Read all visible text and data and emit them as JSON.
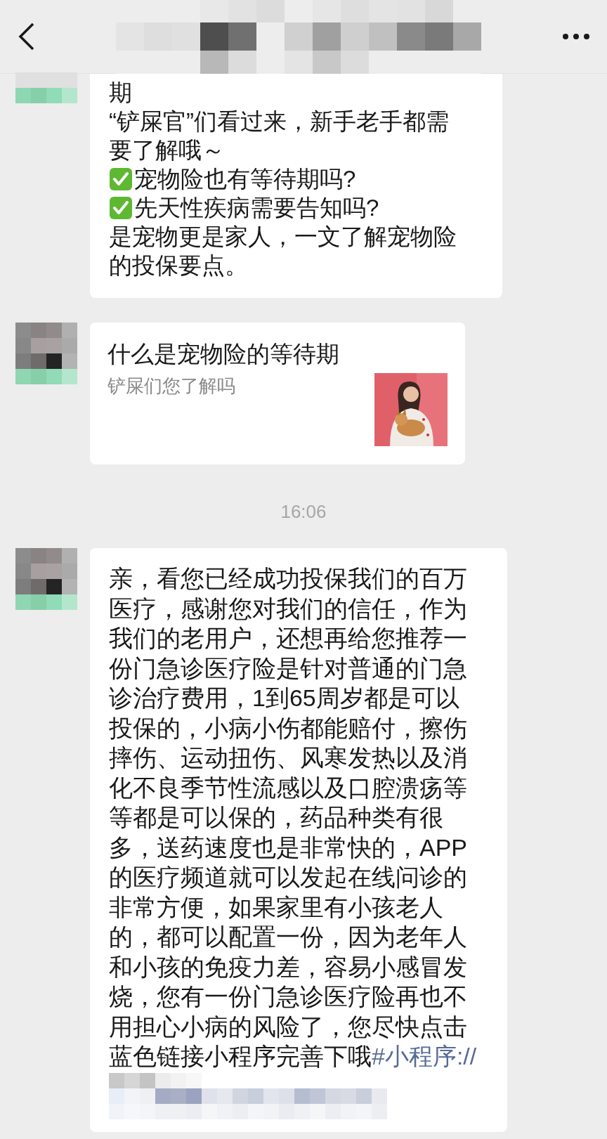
{
  "messages": [
    {
      "kind": "text",
      "lines": [
        {
          "kind": "plain",
          "text": "期"
        },
        {
          "kind": "plain",
          "text": "“铲屎官”们看过来，新手老手都需"
        },
        {
          "kind": "plain",
          "text": "要了解哦～"
        },
        {
          "kind": "check",
          "text": "宠物险也有等待期吗?"
        },
        {
          "kind": "check",
          "text": "先天性疾病需要告知吗?"
        },
        {
          "kind": "plain",
          "text": "是宠物更是家人，一文了解宠物险"
        },
        {
          "kind": "plain",
          "text": "的投保要点。"
        }
      ]
    },
    {
      "kind": "link_card",
      "title": "什么是宠物险的等待期",
      "description": "铲屎们您了解吗"
    },
    {
      "kind": "timestamp",
      "text": "16:06"
    },
    {
      "kind": "text",
      "lines": [
        {
          "kind": "plain",
          "text": "亲，看您已经成功投保我们的百万"
        },
        {
          "kind": "plain",
          "text": "医疗，感谢您对我们的信任，作为"
        },
        {
          "kind": "plain",
          "text": "我们的老用户，还想再给您推荐一"
        },
        {
          "kind": "plain",
          "text": "份门急诊医疗险是针对普通的门急"
        },
        {
          "kind": "plain",
          "text": "诊治疗费用，1到65周岁都是可以"
        },
        {
          "kind": "plain",
          "text": "投保的，小病小伤都能赔付，擦伤"
        },
        {
          "kind": "plain",
          "text": "摔伤、运动扭伤、风寒发热以及消"
        },
        {
          "kind": "plain",
          "text": "化不良季节性流感以及口腔溃疡等"
        },
        {
          "kind": "plain",
          "text": "等都是可以保的，药品种类有很"
        },
        {
          "kind": "plain",
          "text": "多，送药速度也是非常快的，APP"
        },
        {
          "kind": "plain",
          "text": "的医疗频道就可以发起在线问诊的"
        },
        {
          "kind": "plain",
          "text": "非常方便，如果家里有小孩老人"
        },
        {
          "kind": "plain",
          "text": "的，都可以配置一份，因为老年人"
        },
        {
          "kind": "plain",
          "text": "和小孩的免疫力差，容易小感冒发"
        },
        {
          "kind": "plain",
          "text": "烧，您有一份门急诊医疗险再也不"
        },
        {
          "kind": "plain",
          "text": "用担心小病的风险了，您尽快点击"
        },
        {
          "kind": "plain",
          "text": "蓝色链接小程序完善下哦"
        }
      ],
      "link": "#小程序://"
    }
  ]
}
